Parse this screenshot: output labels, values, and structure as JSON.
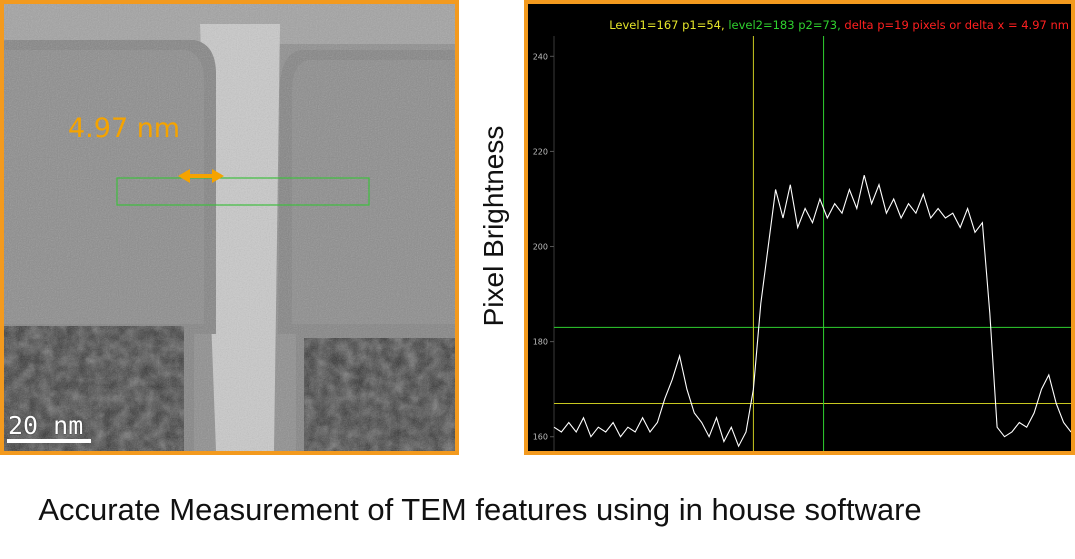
{
  "tem_image": {
    "measurement_label": "4.97 nm",
    "scale_bar_label": "20 nm",
    "colors": {
      "border": "#f39a1e",
      "measurement": "#f5a300",
      "roi_box": "#3fbf3f"
    }
  },
  "profile_plot": {
    "y_axis_title": "Pixel Brightness",
    "legend": {
      "level1": "Level1=167 p1=54,",
      "level2": "level2=183 p2=73,",
      "delta": "delta p=19 pixels or delta x = 4.97 nm",
      "colors": {
        "level1": "#e6e62a",
        "level2": "#2fd12f",
        "delta": "#ff2020"
      }
    }
  },
  "caption": "Accurate Measurement of TEM features using in house software",
  "chart_data": {
    "type": "line",
    "title": "",
    "xlabel": "",
    "ylabel": "Pixel Brightness",
    "ylim": [
      157,
      251
    ],
    "xlim": [
      0,
      140
    ],
    "yticks": [
      160,
      180,
      200,
      220,
      240
    ],
    "grid": false,
    "series": [
      {
        "color": "#ffffff",
        "x": [
          0,
          2,
          4,
          6,
          8,
          10,
          12,
          14,
          16,
          18,
          20,
          22,
          24,
          26,
          28,
          30,
          32,
          34,
          36,
          38,
          40,
          42,
          44,
          46,
          48,
          50,
          52,
          54,
          56,
          58,
          60,
          62,
          64,
          66,
          68,
          70,
          72,
          74,
          76,
          78,
          80,
          82,
          84,
          86,
          88,
          90,
          92,
          94,
          96,
          98,
          100,
          102,
          104,
          106,
          108,
          110,
          112,
          114,
          116,
          118,
          120,
          122,
          124,
          126,
          128,
          130,
          132,
          134,
          136,
          138,
          140
        ],
        "y": [
          162,
          161,
          163,
          161,
          164,
          160,
          162,
          161,
          163,
          160,
          162,
          161,
          164,
          161,
          163,
          168,
          172,
          177,
          170,
          165,
          163,
          160,
          164,
          159,
          162,
          158,
          161,
          170,
          188,
          200,
          212,
          206,
          213,
          204,
          208,
          205,
          210,
          206,
          209,
          207,
          212,
          208,
          215,
          209,
          213,
          207,
          210,
          206,
          209,
          207,
          211,
          206,
          208,
          206,
          207,
          204,
          208,
          203,
          205,
          186,
          162,
          160,
          161,
          163,
          162,
          165,
          170,
          173,
          167,
          163,
          161
        ]
      }
    ],
    "guides": [
      {
        "orientation": "horizontal",
        "value": 167,
        "color": "#c8c820"
      },
      {
        "orientation": "horizontal",
        "value": 183,
        "color": "#2fd12f"
      },
      {
        "orientation": "vertical",
        "value": 54,
        "color": "#c8c820"
      },
      {
        "orientation": "vertical",
        "value": 73,
        "color": "#2fd12f"
      }
    ]
  }
}
